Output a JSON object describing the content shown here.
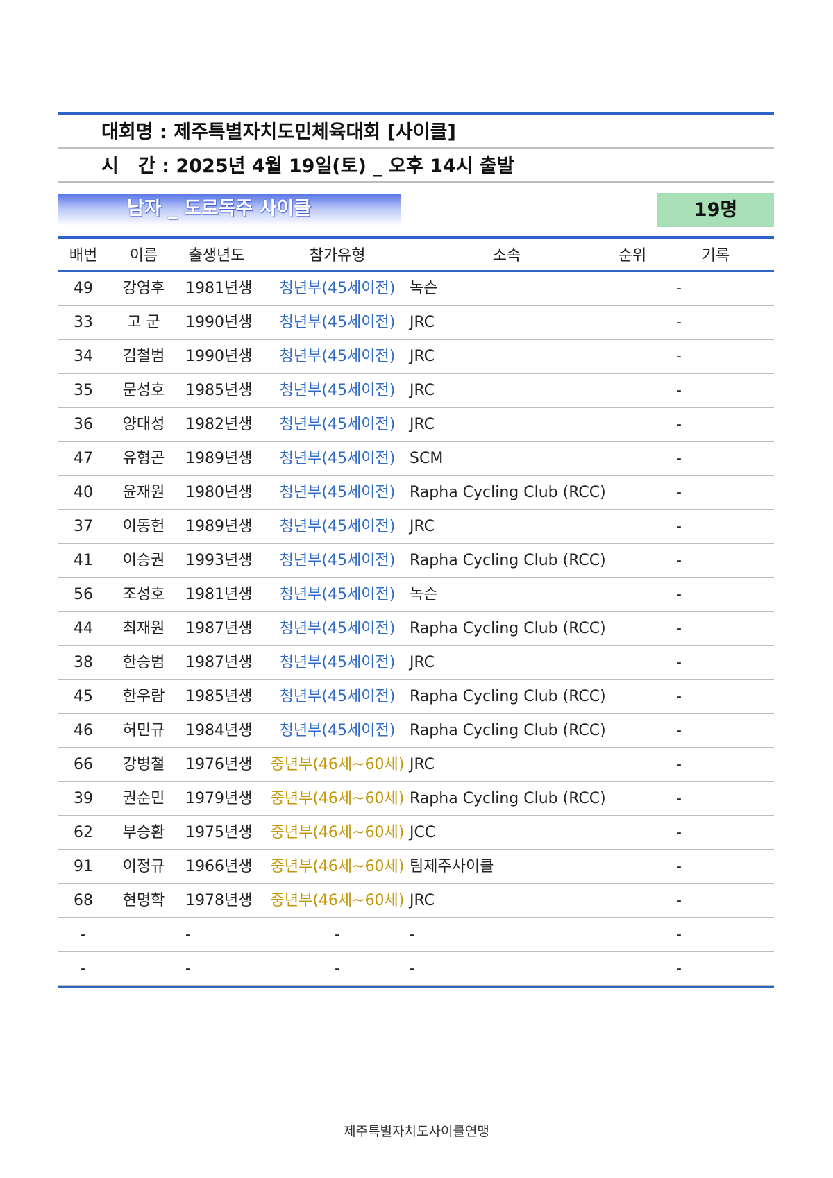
{
  "header": {
    "event_line": "대회명 : 제주특별자치도민체육대회 [사이클]",
    "time_line": "시   간 : 2025년 4월 19일(토) _ 오후 14시 출발"
  },
  "category": {
    "title": "남자 _ 도로독주 사이클",
    "count": "19명"
  },
  "columns": {
    "number": "배번",
    "name": "이름",
    "birth_year": "출생년도",
    "type": "참가유형",
    "club": "소속",
    "rank": "순위",
    "record": "기록"
  },
  "colors": {
    "youth_type": "#2f6ac7",
    "middle_type": "#c4970a",
    "rule_blue": "#2f63c8",
    "count_box": "#a9dfb6"
  },
  "rows": [
    {
      "num": "49",
      "name": "강영후",
      "year": "1981년생",
      "type": "청년부(45세이전)",
      "type_class": "youth",
      "club": "녹슨",
      "rank": "-",
      "record": ""
    },
    {
      "num": "33",
      "name": "고 군",
      "year": "1990년생",
      "type": "청년부(45세이전)",
      "type_class": "youth",
      "club": "JRC",
      "rank": "-",
      "record": ""
    },
    {
      "num": "34",
      "name": "김철범",
      "year": "1990년생",
      "type": "청년부(45세이전)",
      "type_class": "youth",
      "club": "JRC",
      "rank": "-",
      "record": ""
    },
    {
      "num": "35",
      "name": "문성호",
      "year": "1985년생",
      "type": "청년부(45세이전)",
      "type_class": "youth",
      "club": "JRC",
      "rank": "-",
      "record": ""
    },
    {
      "num": "36",
      "name": "양대성",
      "year": "1982년생",
      "type": "청년부(45세이전)",
      "type_class": "youth",
      "club": "JRC",
      "rank": "-",
      "record": ""
    },
    {
      "num": "47",
      "name": "유형곤",
      "year": "1989년생",
      "type": "청년부(45세이전)",
      "type_class": "youth",
      "club": "SCM",
      "rank": "-",
      "record": ""
    },
    {
      "num": "40",
      "name": "윤재원",
      "year": "1980년생",
      "type": "청년부(45세이전)",
      "type_class": "youth",
      "club": "Rapha Cycling Club (RCC)",
      "rank": "-",
      "record": ""
    },
    {
      "num": "37",
      "name": "이동헌",
      "year": "1989년생",
      "type": "청년부(45세이전)",
      "type_class": "youth",
      "club": "JRC",
      "rank": "-",
      "record": ""
    },
    {
      "num": "41",
      "name": "이승권",
      "year": "1993년생",
      "type": "청년부(45세이전)",
      "type_class": "youth",
      "club": "Rapha Cycling Club (RCC)",
      "rank": "-",
      "record": ""
    },
    {
      "num": "56",
      "name": "조성호",
      "year": "1981년생",
      "type": "청년부(45세이전)",
      "type_class": "youth",
      "club": "녹슨",
      "rank": "-",
      "record": ""
    },
    {
      "num": "44",
      "name": "최재원",
      "year": "1987년생",
      "type": "청년부(45세이전)",
      "type_class": "youth",
      "club": "Rapha Cycling Club (RCC)",
      "rank": "-",
      "record": ""
    },
    {
      "num": "38",
      "name": "한승범",
      "year": "1987년생",
      "type": "청년부(45세이전)",
      "type_class": "youth",
      "club": "JRC",
      "rank": "-",
      "record": ""
    },
    {
      "num": "45",
      "name": "한우람",
      "year": "1985년생",
      "type": "청년부(45세이전)",
      "type_class": "youth",
      "club": "Rapha Cycling Club (RCC)",
      "rank": "-",
      "record": ""
    },
    {
      "num": "46",
      "name": "허민규",
      "year": "1984년생",
      "type": "청년부(45세이전)",
      "type_class": "youth",
      "club": "Rapha Cycling Club (RCC)",
      "rank": "-",
      "record": ""
    },
    {
      "num": "66",
      "name": "강병철",
      "year": "1976년생",
      "type": "중년부(46세~60세)",
      "type_class": "middle",
      "club": "JRC",
      "rank": "-",
      "record": ""
    },
    {
      "num": "39",
      "name": "권순민",
      "year": "1979년생",
      "type": "중년부(46세~60세)",
      "type_class": "middle",
      "club": "Rapha Cycling Club (RCC)",
      "rank": "-",
      "record": ""
    },
    {
      "num": "62",
      "name": "부승환",
      "year": "1975년생",
      "type": "중년부(46세~60세)",
      "type_class": "middle",
      "club": "JCC",
      "rank": "-",
      "record": ""
    },
    {
      "num": "91",
      "name": "이정규",
      "year": "1966년생",
      "type": "중년부(46세~60세)",
      "type_class": "middle",
      "club": "팀제주사이클",
      "rank": "-",
      "record": ""
    },
    {
      "num": "68",
      "name": "현명학",
      "year": "1978년생",
      "type": "중년부(46세~60세)",
      "type_class": "middle",
      "club": "JRC",
      "rank": "-",
      "record": ""
    },
    {
      "num": "-",
      "name": "",
      "year": "-",
      "type": "-",
      "type_class": "none",
      "club": "-",
      "rank": "-",
      "record": ""
    },
    {
      "num": "-",
      "name": "",
      "year": "-",
      "type": "-",
      "type_class": "none",
      "club": "-",
      "rank": "-",
      "record": ""
    }
  ],
  "footer": {
    "organization": "제주특별자치도사이클연맹"
  }
}
